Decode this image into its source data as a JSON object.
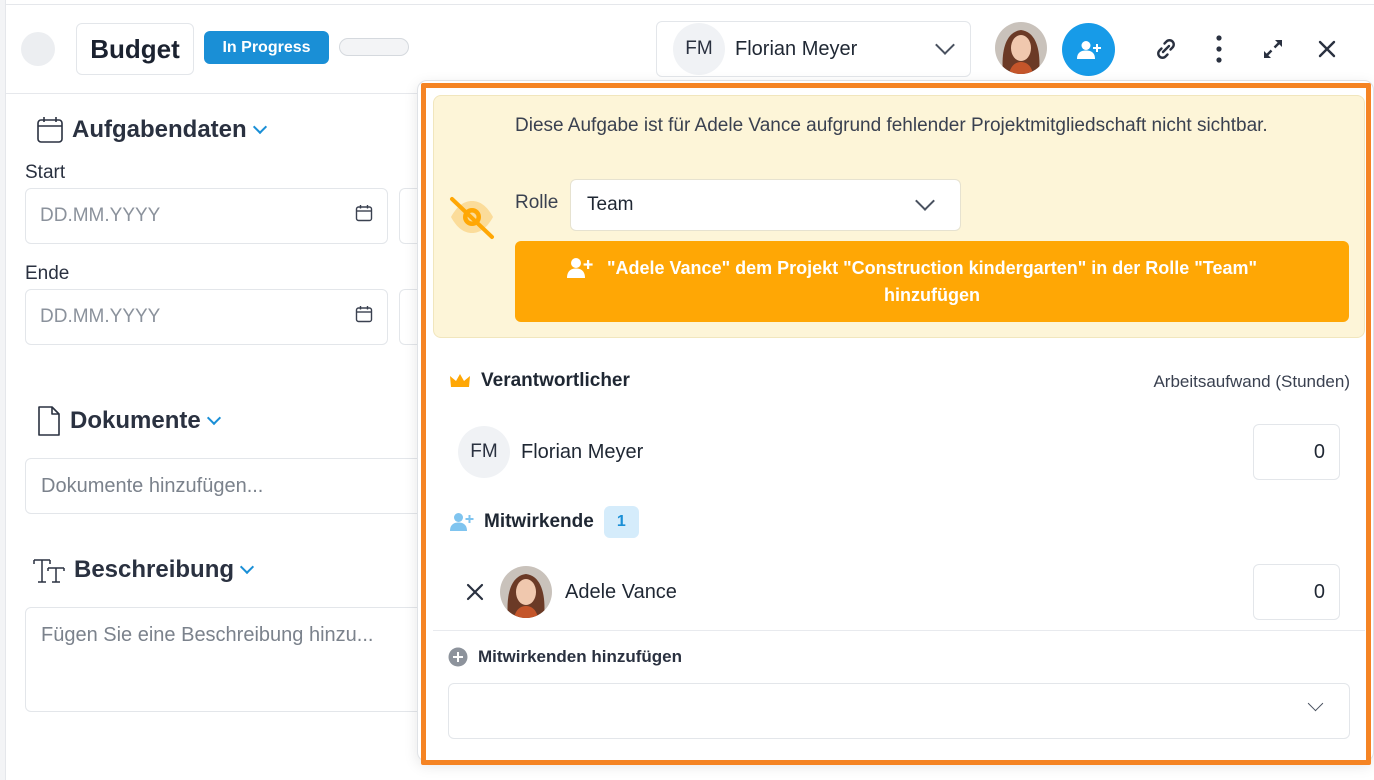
{
  "header": {
    "title": "Budget",
    "status": "In Progress",
    "assignee": {
      "initials": "FM",
      "name": "Florian Meyer"
    }
  },
  "form": {
    "task_data": {
      "heading": "Aufgabendaten",
      "start_label": "Start",
      "start_placeholder": "DD.MM.YYYY",
      "end_label": "Ende",
      "end_placeholder": "DD.MM.YYYY"
    },
    "documents": {
      "heading": "Dokumente",
      "placeholder": "Dokumente hinzufügen..."
    },
    "description": {
      "heading": "Beschreibung",
      "placeholder": "Fügen Sie eine Beschreibung hinzu..."
    }
  },
  "popover": {
    "warning_text": "Diese Aufgabe ist für Adele Vance aufgrund fehlender Projektmitgliedschaft nicht sichtbar.",
    "role_label": "Rolle",
    "role_value": "Team",
    "add_to_project_label": "\"Adele Vance\" dem Projekt \"Construction kindergarten\" in der Rolle \"Team\" hinzufügen",
    "responsible_heading": "Verantwortlicher",
    "effort_heading": "Arbeitsaufwand (Stunden)",
    "responsible": {
      "initials": "FM",
      "name": "Florian Meyer",
      "effort": "0"
    },
    "contributors_heading": "Mitwirkende",
    "contributors_count": "1",
    "contributors": [
      {
        "name": "Adele Vance",
        "effort": "0"
      }
    ],
    "add_contributor_label": "Mitwirkenden hinzufügen"
  },
  "colors": {
    "accent_blue": "#1a8fd6",
    "highlight_orange": "#f58424",
    "warning_bg": "#fdf5d8",
    "warning_button": "#ffa705"
  }
}
